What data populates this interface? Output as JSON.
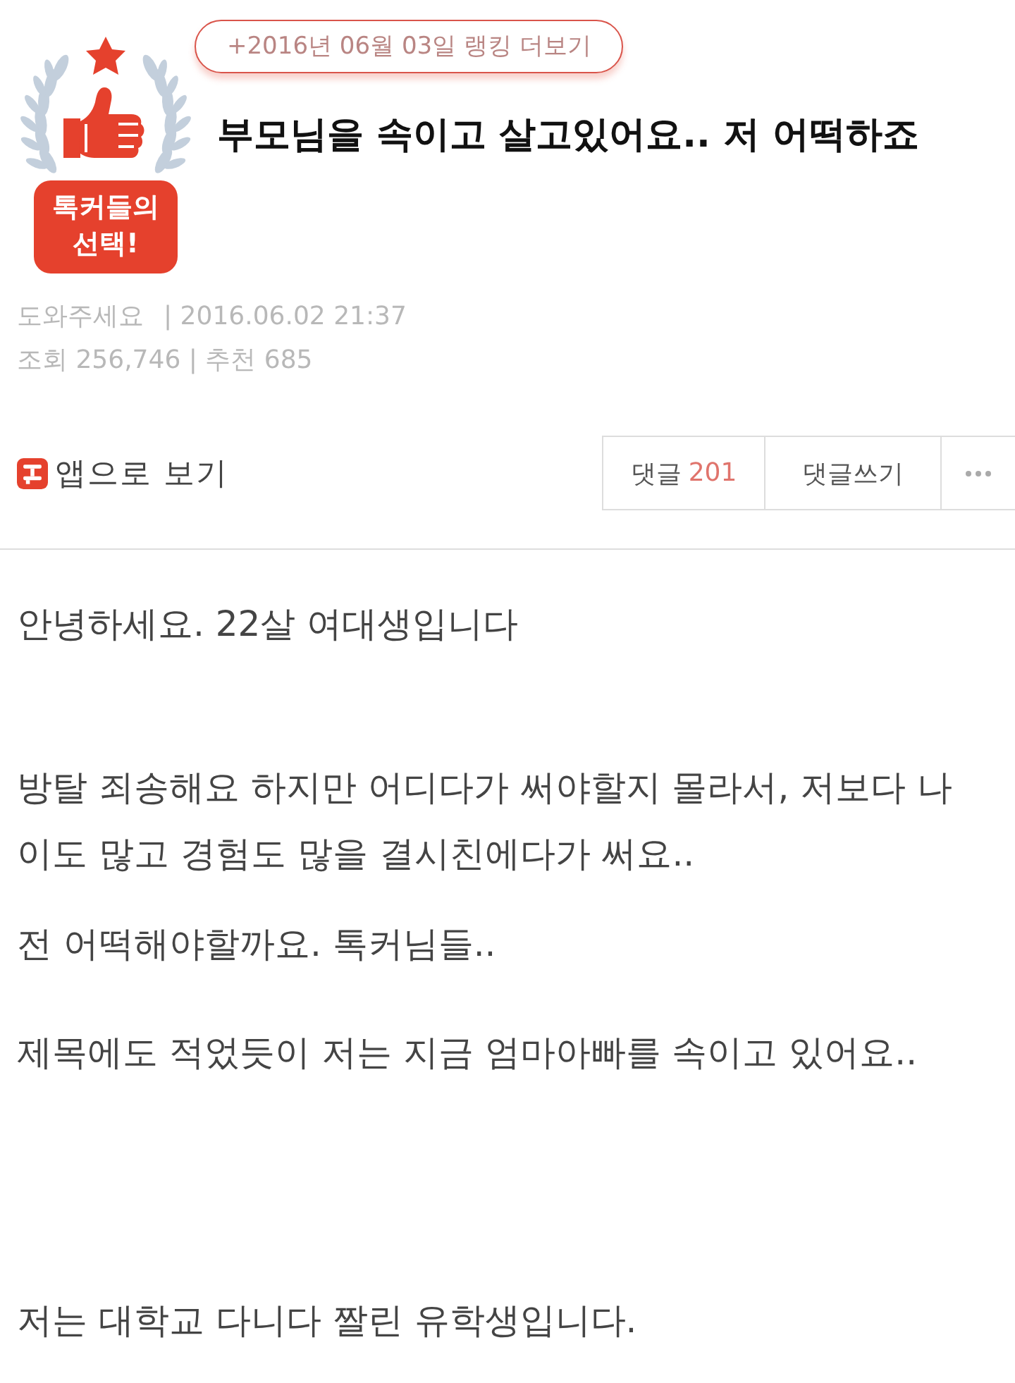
{
  "ranking_link": {
    "label": "+2016년 06월 03일 랭킹 더보기"
  },
  "badge": {
    "label": "톡커들의\n선택!"
  },
  "title": "부모님을 속이고 살고있어요.. 저 어떡하죠",
  "meta": {
    "category": "도와주세요",
    "datetime": "| 2016.06.02 21:37",
    "stats": "조회 256,746 | 추천 685"
  },
  "app_link": {
    "label": "앱으로 보기"
  },
  "actions": [
    {
      "kind": "comments",
      "label": "댓글",
      "count": "201"
    },
    {
      "kind": "write",
      "label": "댓글쓰기"
    },
    {
      "kind": "more"
    }
  ],
  "body": [
    "안녕하세요. 22살 여대생입니다",
    "방탈 죄송해요 하지만 어디다가 써야할지 몰라서, 저보다 나이도 많고 경험도 많을 결시친에다가 써요..",
    "전 어떡해야할까요. 톡커님들..",
    "제목에도 적었듯이 저는 지금 엄마아빠를 속이고 있어요..",
    "저는 대학교 다니다 짤린 유학생입니다."
  ]
}
